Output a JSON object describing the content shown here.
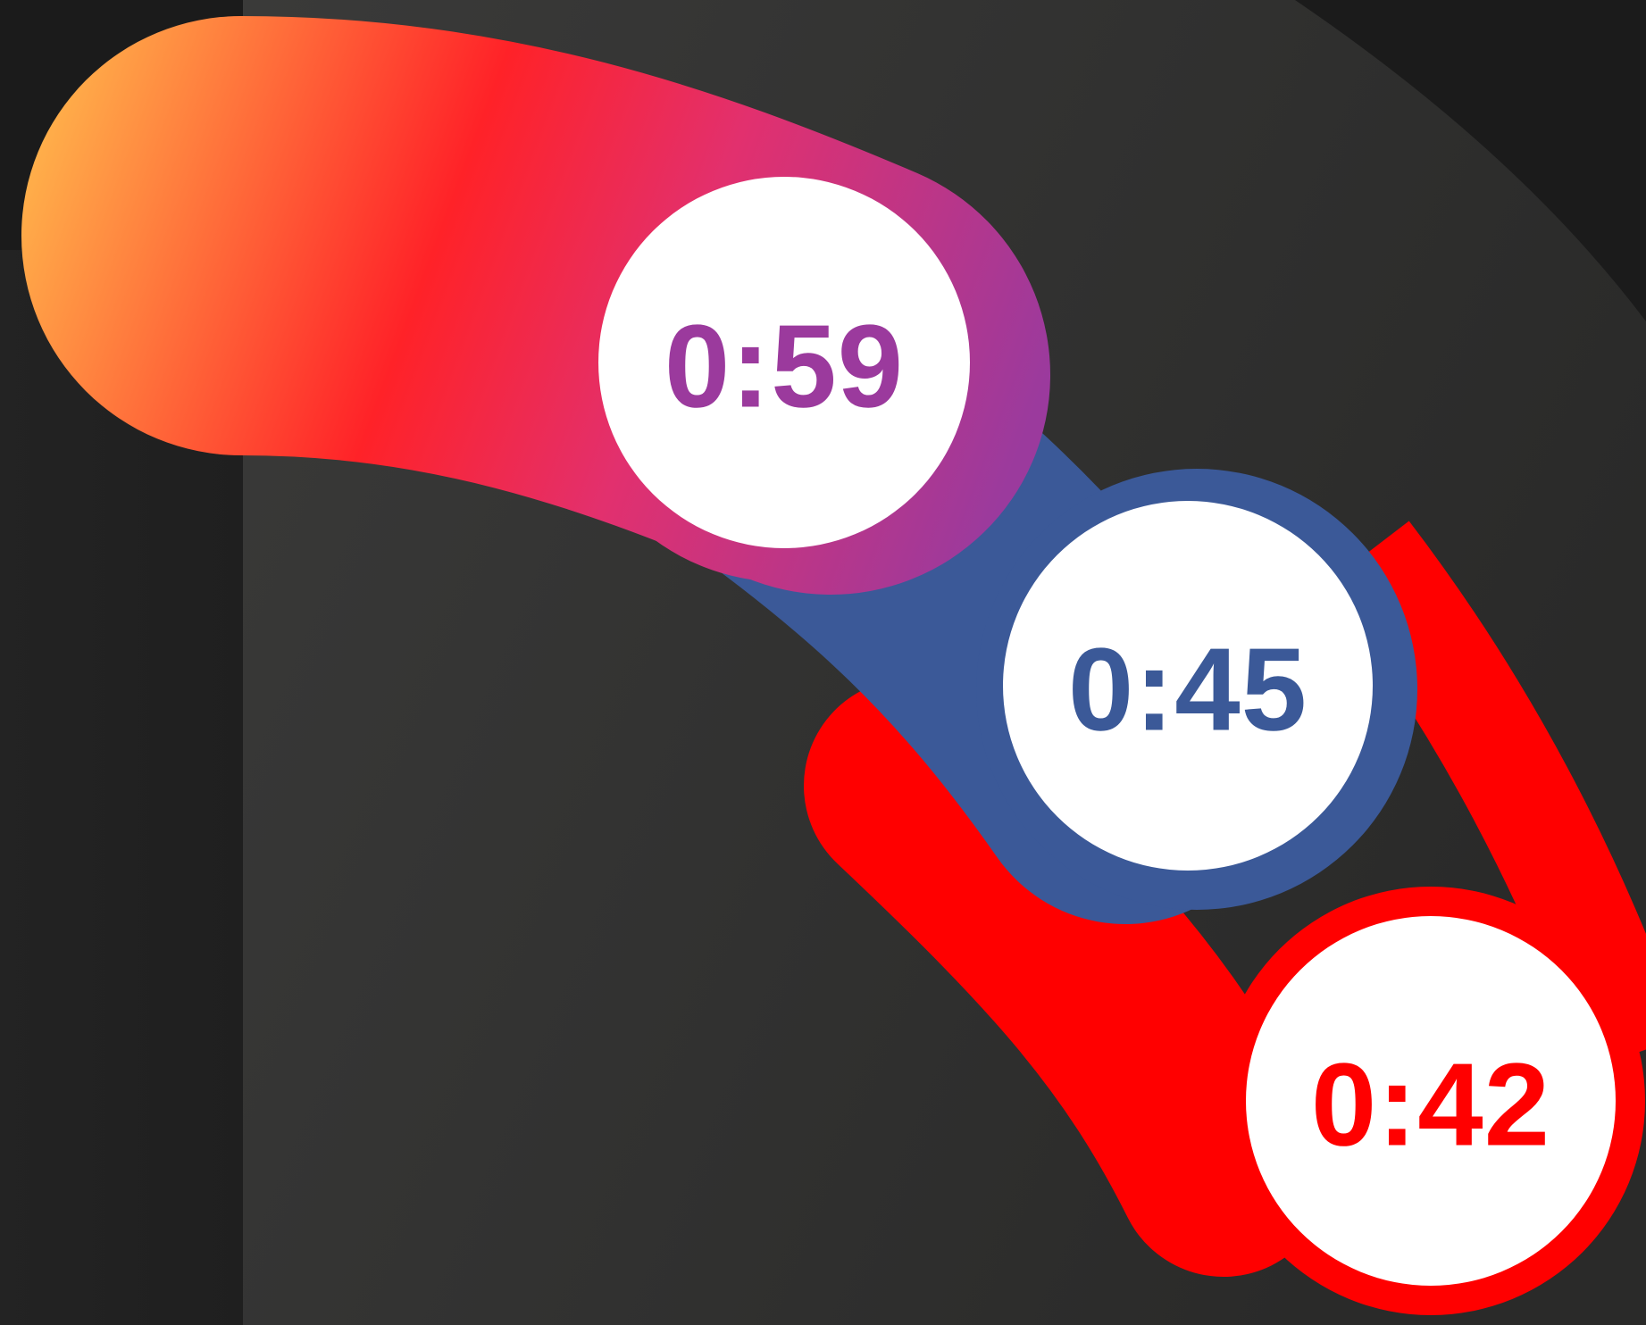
{
  "timers": [
    {
      "label": "0:59",
      "color": "#9b3a9d",
      "ring_color": "gradient"
    },
    {
      "label": "0:45",
      "color": "#3b5998",
      "ring_color": "#3b5998"
    },
    {
      "label": "0:42",
      "color": "#ff0000",
      "ring_color": "#ff0000"
    }
  ],
  "colors": {
    "background": "#1b1b1b",
    "panel": "#2c2c2b",
    "track_red": "#ff0000",
    "track_blue": "#3b5998",
    "gradient_start": "#ffb04a",
    "gradient_mid": "#ff2228",
    "gradient_mid2": "#e2306e",
    "gradient_end": "#9b3a9d",
    "badge_fill": "#ffffff"
  }
}
